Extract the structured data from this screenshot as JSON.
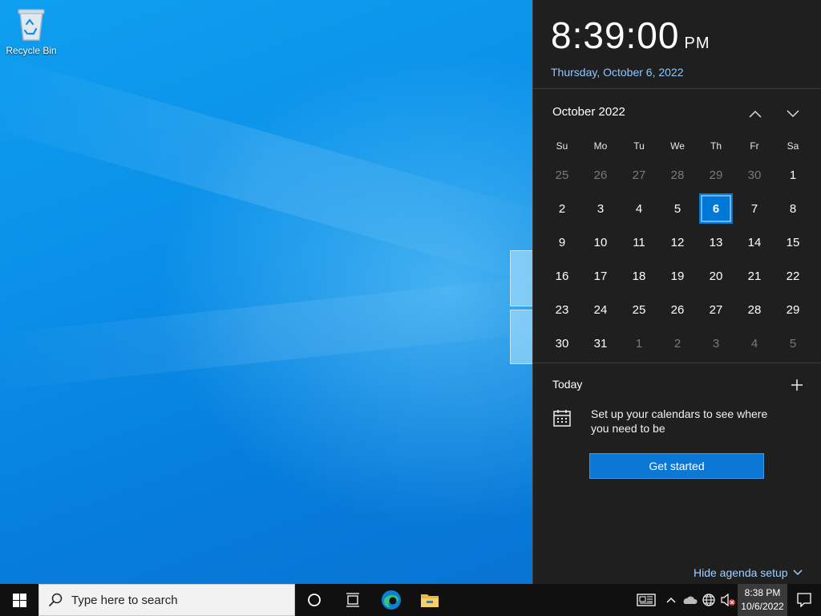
{
  "desktop": {
    "icons": [
      {
        "label": "Recycle Bin",
        "icon": "recycle-bin-icon"
      }
    ]
  },
  "flyout": {
    "time": "8:39:00",
    "ampm": "PM",
    "date": "Thursday, October 6, 2022",
    "month_label": "October 2022",
    "weekdays": [
      "Su",
      "Mo",
      "Tu",
      "We",
      "Th",
      "Fr",
      "Sa"
    ],
    "weeks": [
      [
        "25",
        "26",
        "27",
        "28",
        "29",
        "30",
        "1"
      ],
      [
        "2",
        "3",
        "4",
        "5",
        "6",
        "7",
        "8"
      ],
      [
        "9",
        "10",
        "11",
        "12",
        "13",
        "14",
        "15"
      ],
      [
        "16",
        "17",
        "18",
        "19",
        "20",
        "21",
        "22"
      ],
      [
        "23",
        "24",
        "25",
        "26",
        "27",
        "28",
        "29"
      ],
      [
        "30",
        "31",
        "1",
        "2",
        "3",
        "4",
        "5"
      ]
    ],
    "selected_day": "6",
    "agenda": {
      "today_label": "Today",
      "setup_text": "Set up your calendars to see where you need to be",
      "button_label": "Get started",
      "hide_label": "Hide agenda setup"
    }
  },
  "taskbar": {
    "search_placeholder": "Type here to search",
    "tray_time": "8:38 PM",
    "tray_date": "10/6/2022"
  },
  "colors": {
    "accent": "#0078d7",
    "flyout_bg": "#1f1f1f",
    "taskbar_bg": "#101010",
    "date_link": "#8fc7ff"
  }
}
